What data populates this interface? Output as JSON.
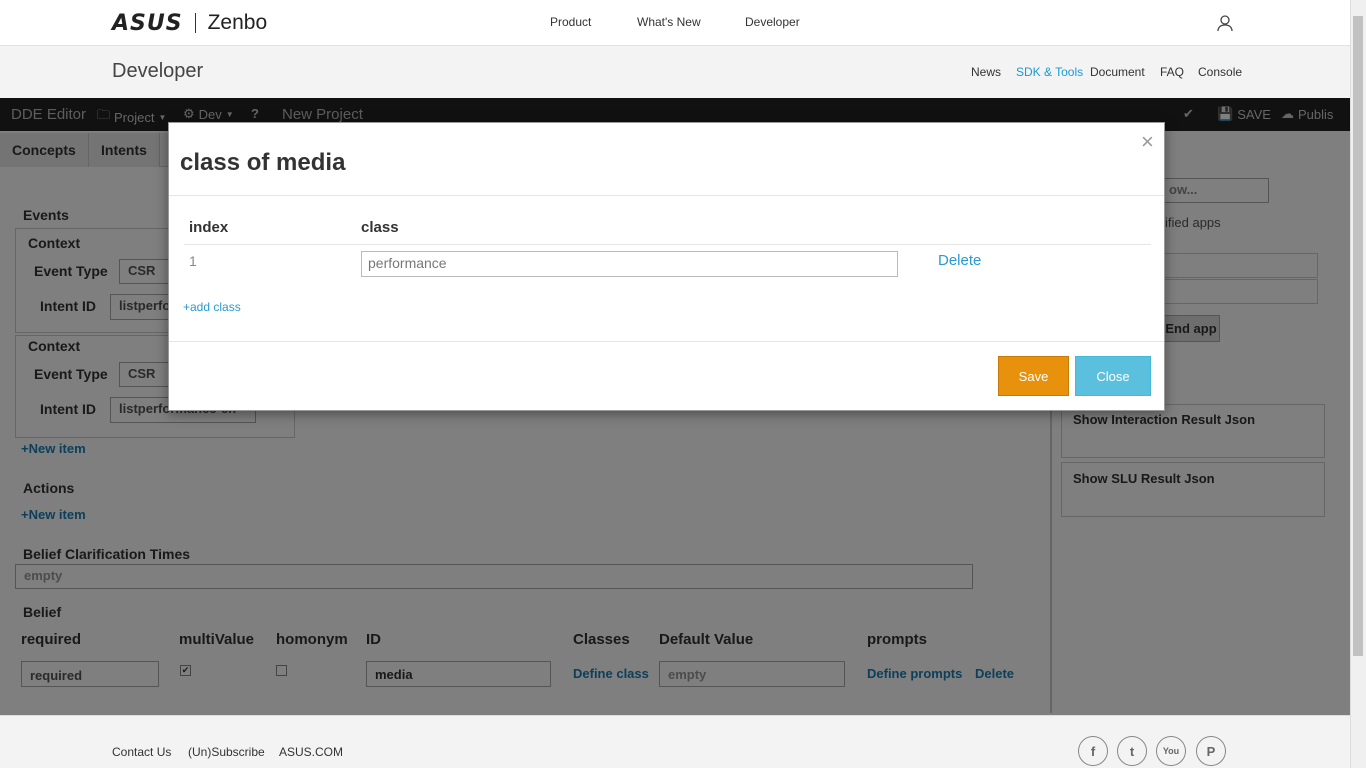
{
  "site": {
    "brand": "ASUS",
    "product": "Zenbo",
    "nav": [
      "Product",
      "What's New",
      "Developer"
    ],
    "section_title": "Developer",
    "subnav": [
      "News",
      "SDK & Tools",
      "Document",
      "FAQ",
      "Console"
    ],
    "subnav_active": "SDK & Tools"
  },
  "toolbar": {
    "app_name": "DDE Editor",
    "project_menu": "Project",
    "dev_menu": "Dev",
    "help": "?",
    "project_name": "New Project",
    "save": "SAVE",
    "publish": "Publis"
  },
  "editor": {
    "tabs": [
      "Concepts",
      "Intents"
    ],
    "events_label": "Events",
    "contexts": [
      {
        "label": "Context",
        "event_type_label": "Event Type",
        "event_type": "CSR",
        "intent_id_label": "Intent ID",
        "intent_id": "listperfo"
      },
      {
        "label": "Context",
        "event_type_label": "Event Type",
        "event_type": "CSR",
        "intent_id_label": "Intent ID",
        "intent_id": "listperformance-en"
      }
    ],
    "new_item": "+New item",
    "actions_label": "Actions",
    "actions_new_item": "+New item",
    "belief_clarification_label": "Belief Clarification Times",
    "belief_clarification_value": "empty",
    "belief_label": "Belief",
    "belief_headers": [
      "required",
      "multiValue",
      "homonym",
      "ID",
      "Classes",
      "Default Value",
      "prompts"
    ],
    "belief_row": {
      "required": "required",
      "id": "media",
      "define_class": "Define class",
      "default_value_placeholder": "empty",
      "define_prompts": "Define prompts",
      "delete": "Delete"
    }
  },
  "right_panel": {
    "search_placeholder": "ow...",
    "verified_apps": "ified apps",
    "end_app": "End app",
    "interaction_result": "Show Interaction Result Json",
    "slu_result": "Show SLU Result Json"
  },
  "modal": {
    "title": "class of media",
    "close_glyph": "×",
    "col_index": "index",
    "col_class": "class",
    "rows": [
      {
        "index": "1",
        "class": "performance",
        "delete": "Delete"
      }
    ],
    "add_class": "+add class",
    "save": "Save",
    "close": "Close"
  },
  "footer": {
    "links": [
      "Contact Us",
      "(Un)Subscribe",
      "ASUS.COM"
    ],
    "social": [
      "f",
      "t",
      "You",
      "P"
    ]
  },
  "colors": {
    "accent": "#1a9ad6",
    "save": "#e8910c",
    "close": "#5bc0de",
    "toolbar": "#222222"
  }
}
